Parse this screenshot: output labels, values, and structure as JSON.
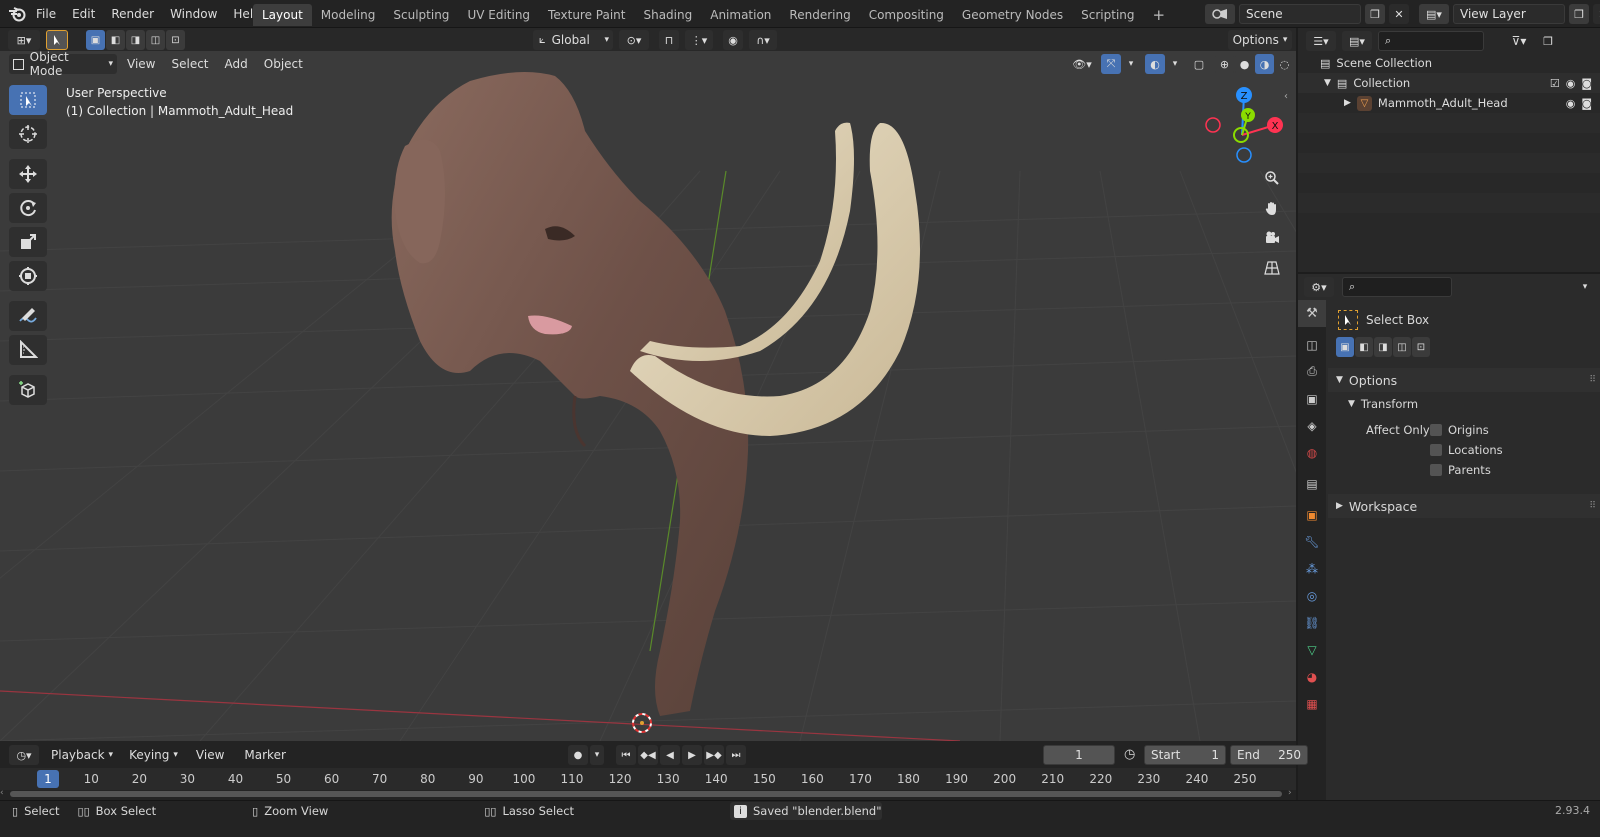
{
  "topbar": {
    "menus": [
      "File",
      "Edit",
      "Render",
      "Window",
      "Help"
    ],
    "workspaces": [
      "Layout",
      "Modeling",
      "Sculpting",
      "UV Editing",
      "Texture Paint",
      "Shading",
      "Animation",
      "Rendering",
      "Compositing",
      "Geometry Nodes",
      "Scripting"
    ],
    "active_workspace": "Layout",
    "add_tab": "+",
    "scene": "Scene",
    "view_layer": "View Layer"
  },
  "tool_header": {
    "orientation": "Global",
    "options": "Options"
  },
  "viewport_header": {
    "mode": "Object Mode",
    "menus": [
      "View",
      "Select",
      "Add",
      "Object"
    ]
  },
  "viewport": {
    "perspective": "User Perspective",
    "collection_info": "(1) Collection | Mammoth_Adult_Head",
    "axes": {
      "z": "Z",
      "y": "Y",
      "x": "X"
    }
  },
  "toolbar": [
    "select-box",
    "cursor",
    "move",
    "rotate",
    "scale",
    "transform",
    "annotate",
    "measure",
    "add-cube"
  ],
  "outliner": {
    "root": "Scene Collection",
    "collection": "Collection",
    "object": "Mammoth_Adult_Head"
  },
  "properties": {
    "tool_name": "Select Box",
    "options_label": "Options",
    "transform_label": "Transform",
    "affect_only_label": "Affect Only",
    "checkboxes": [
      "Origins",
      "Locations",
      "Parents"
    ],
    "workspace_label": "Workspace"
  },
  "timeline": {
    "menus": [
      "Playback",
      "Keying",
      "View",
      "Marker"
    ],
    "current_frame": "1",
    "start_label": "Start",
    "start": "1",
    "end_label": "End",
    "end": "250",
    "ticks": [
      "1",
      "10",
      "20",
      "30",
      "40",
      "50",
      "60",
      "70",
      "80",
      "90",
      "100",
      "110",
      "120",
      "130",
      "140",
      "150",
      "160",
      "170",
      "180",
      "190",
      "200",
      "210",
      "220",
      "230",
      "240",
      "250"
    ]
  },
  "statusbar": {
    "select": "Select",
    "box_select": "Box Select",
    "zoom_view": "Zoom View",
    "lasso_select": "Lasso Select",
    "message": "Saved \"blender.blend\"",
    "version": "2.93.4"
  },
  "colors": {
    "accent": "#4772b3",
    "x_axis": "#ff3352",
    "y_axis": "#8bdc00",
    "z_axis": "#2890ff"
  }
}
